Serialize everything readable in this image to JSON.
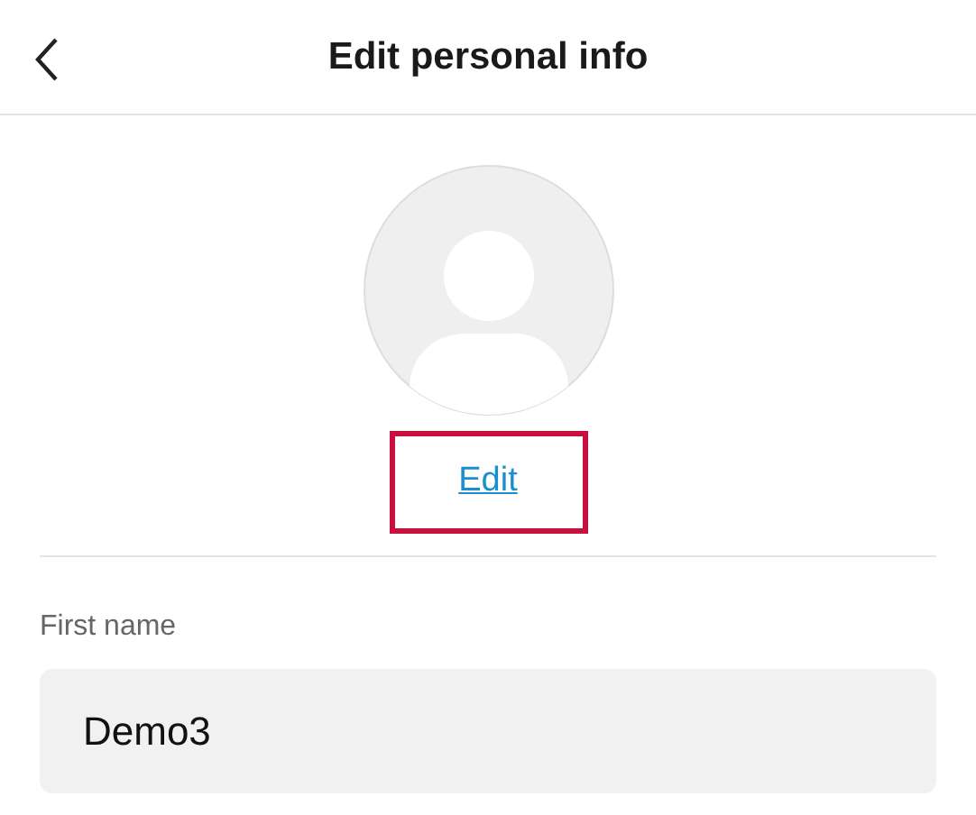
{
  "header": {
    "title": "Edit personal info"
  },
  "photo": {
    "edit_link": "Edit",
    "highlighted": true
  },
  "fields": [
    {
      "label": "First name",
      "value": "Demo3"
    }
  ]
}
